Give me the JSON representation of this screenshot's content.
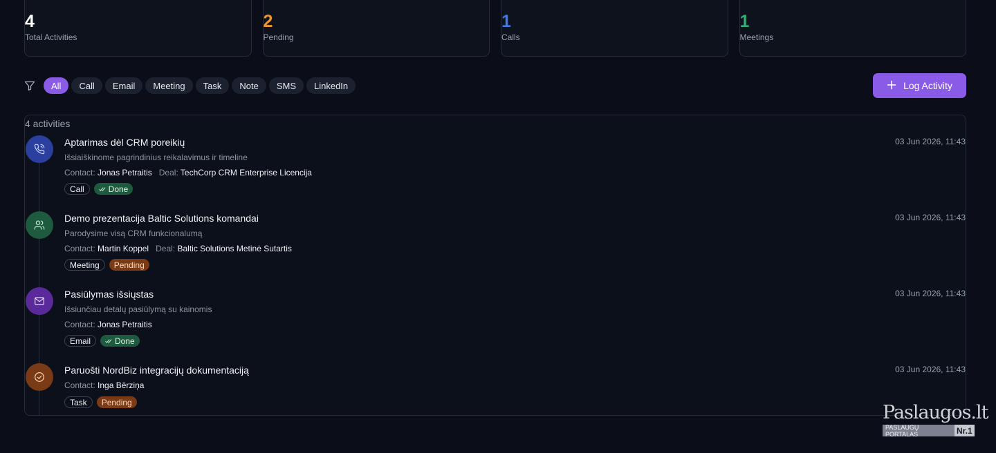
{
  "stats": [
    {
      "value": "4",
      "label": "Total Activities",
      "color": "#ffffff"
    },
    {
      "value": "2",
      "label": "Pending",
      "color": "#f0952b"
    },
    {
      "value": "1",
      "label": "Calls",
      "color": "#3f7be8"
    },
    {
      "value": "1",
      "label": "Meetings",
      "color": "#2fb07a"
    }
  ],
  "filters": {
    "chips": [
      "All",
      "Call",
      "Email",
      "Meeting",
      "Task",
      "Note",
      "SMS",
      "LinkedIn"
    ],
    "active": "All"
  },
  "log_button": {
    "label": "Log Activity"
  },
  "list": {
    "count_label": "4 activities",
    "items": [
      {
        "title": "Aptarimas dėl CRM poreikių",
        "description": "Išsiaiškinome pagrindinius reikalavimus ir timeline",
        "contact_label": "Contact:",
        "contact": "Jonas Petraitis",
        "deal_label": "Deal:",
        "deal": "TechCorp CRM Enterprise Licencija",
        "type": "Call",
        "status": "Done",
        "date": "03 Jun 2026, 11:43",
        "icon": "phone-icon",
        "icon_bg": "#2b3f9e"
      },
      {
        "title": "Demo prezentacija Baltic Solutions komandai",
        "description": "Parodysime visą CRM funkcionalumą",
        "contact_label": "Contact:",
        "contact": "Martin Koppel",
        "deal_label": "Deal:",
        "deal": "Baltic Solutions Metinė Sutartis",
        "type": "Meeting",
        "status": "Pending",
        "date": "03 Jun 2026, 11:43",
        "icon": "users-icon",
        "icon_bg": "#1e5a3d"
      },
      {
        "title": "Pasiūlymas išsiųstas",
        "description": "Išsiunčiau detalų pasiūlymą su kainomis",
        "contact_label": "Contact:",
        "contact": "Jonas Petraitis",
        "type": "Email",
        "status": "Done",
        "date": "03 Jun 2026, 11:43",
        "icon": "mail-icon",
        "icon_bg": "#5a2a9a"
      },
      {
        "title": "Paruošti NordBiz integracijų dokumentaciją",
        "contact_label": "Contact:",
        "contact": "Inga Bērziņa",
        "type": "Task",
        "status": "Pending",
        "date": "03 Jun 2026, 11:43",
        "icon": "check-circle-icon",
        "icon_bg": "#7a3a16"
      }
    ]
  },
  "watermark": {
    "title": "Paslaugos.lt",
    "subtitle": "PASLAUGŲ PORTALAS",
    "badge": "Nr.1"
  }
}
